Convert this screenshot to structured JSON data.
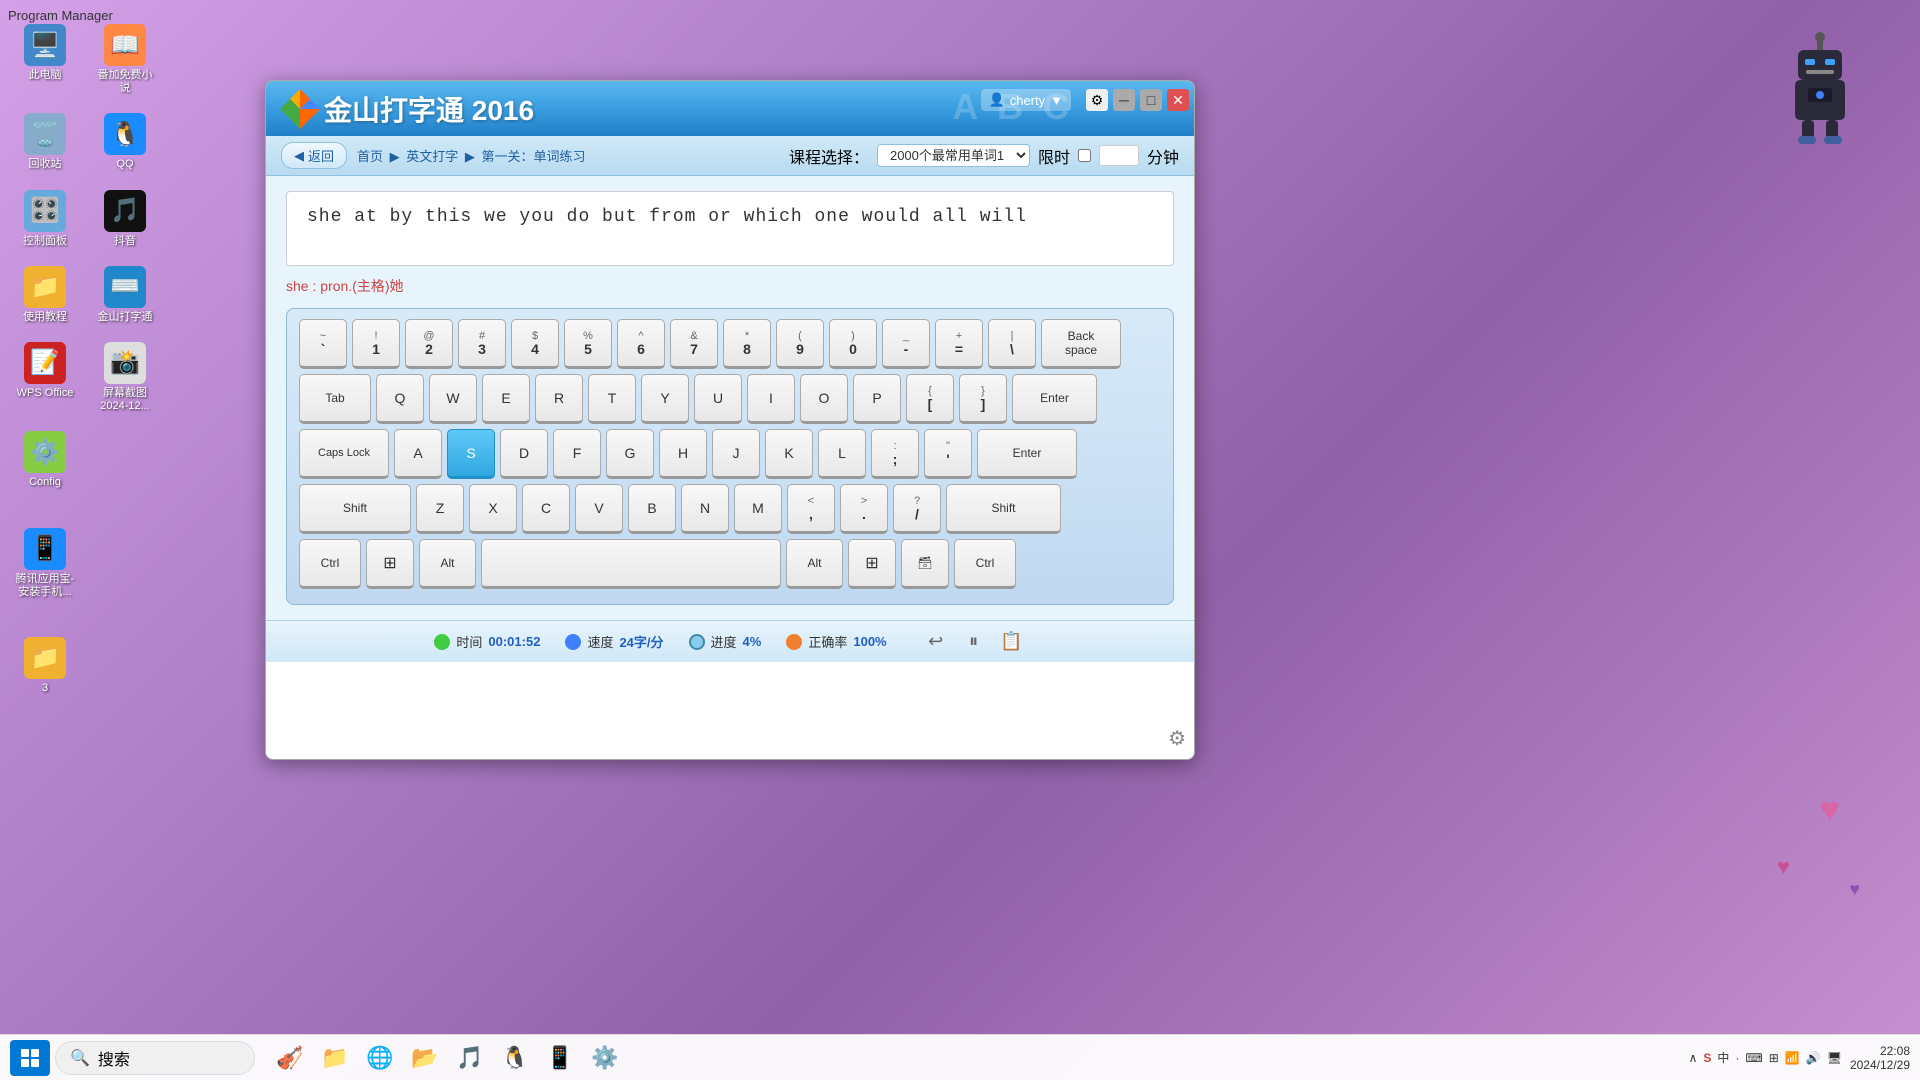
{
  "program_manager": "Program Manager",
  "desktop_icons": [
    {
      "id": "computer",
      "label": "此电脑",
      "emoji": "🖥️"
    },
    {
      "id": "novel",
      "label": "番加免费小说",
      "emoji": "📖"
    },
    {
      "id": "recycle",
      "label": "回收站",
      "emoji": "🗑️"
    },
    {
      "id": "qq",
      "label": "QQ",
      "emoji": "🐧"
    },
    {
      "id": "control",
      "label": "控制面板",
      "emoji": "🎛️"
    },
    {
      "id": "douyin",
      "label": "抖音",
      "emoji": "🎵"
    },
    {
      "id": "folder",
      "label": "使用教程",
      "emoji": "📁"
    },
    {
      "id": "typing",
      "label": "金山打字通",
      "emoji": "⌨️"
    },
    {
      "id": "wps",
      "label": "WPS Office",
      "emoji": "📝"
    },
    {
      "id": "screenshot",
      "label": "屏幕截图 2024-12...",
      "emoji": "📸"
    },
    {
      "id": "config",
      "label": "Config",
      "emoji": "⚙️"
    },
    {
      "id": "tencent",
      "label": "腾讯应用宝-安装手机...",
      "emoji": "📱"
    },
    {
      "id": "folder2",
      "label": "3",
      "emoji": "📁"
    }
  ],
  "app": {
    "title": "金山打字通 2016",
    "user": "cherty",
    "nav": {
      "back": "返回",
      "home": "首页",
      "english": "英文打字",
      "lesson": "第一关：单词练习"
    },
    "course_label": "课程选择：",
    "course_value": "2000个最常用单词1",
    "timer_label": "限时",
    "timer_unit": "分钟",
    "typing_text": "she at by this we you do but from or which one would all will",
    "word_hint": "she : pron.(主格)她",
    "current_key": "S",
    "keyboard": {
      "row0": [
        {
          "top": "~",
          "bottom": "`"
        },
        {
          "top": "!",
          "bottom": "1"
        },
        {
          "top": "@",
          "bottom": "2"
        },
        {
          "top": "#",
          "bottom": "3"
        },
        {
          "top": "$",
          "bottom": "4"
        },
        {
          "top": "%",
          "bottom": "5"
        },
        {
          "top": "^",
          "bottom": "6"
        },
        {
          "top": "&",
          "bottom": "7"
        },
        {
          "top": "*",
          "bottom": "8"
        },
        {
          "top": "(",
          "bottom": "9"
        },
        {
          "top": ")",
          "bottom": "0"
        },
        {
          "top": "_",
          "bottom": "-"
        },
        {
          "top": "+",
          "bottom": "="
        },
        {
          "top": "|",
          "bottom": "\\"
        },
        {
          "top": "Back",
          "bottom": "space",
          "special": "backspace"
        }
      ],
      "row1": [
        "Tab",
        "Q",
        "W",
        "E",
        "R",
        "T",
        "Y",
        "U",
        "I",
        "O",
        "P",
        "{[",
        "}]",
        "Enter"
      ],
      "row2": [
        "Caps Lock",
        "A",
        "S",
        "D",
        "F",
        "G",
        "H",
        "J",
        "K",
        "L",
        ":;",
        "\"'",
        "Enter"
      ],
      "row3": [
        "Shift",
        "Z",
        "X",
        "C",
        "V",
        "B",
        "N",
        "M",
        "<,",
        ">.",
        "?/",
        "Shift"
      ],
      "row4": [
        "Ctrl",
        "Win",
        "Alt",
        "Space",
        "Alt",
        "Win",
        "Fn",
        "Ctrl"
      ]
    },
    "status": {
      "time_label": "时间",
      "time_value": "00:01:52",
      "speed_label": "速度",
      "speed_value": "24字/分",
      "progress_label": "进度",
      "progress_value": "4%",
      "accuracy_label": "正确率",
      "accuracy_value": "100%"
    }
  },
  "taskbar": {
    "search_placeholder": "搜索",
    "time": "22:08",
    "date": "2024/12/29"
  }
}
